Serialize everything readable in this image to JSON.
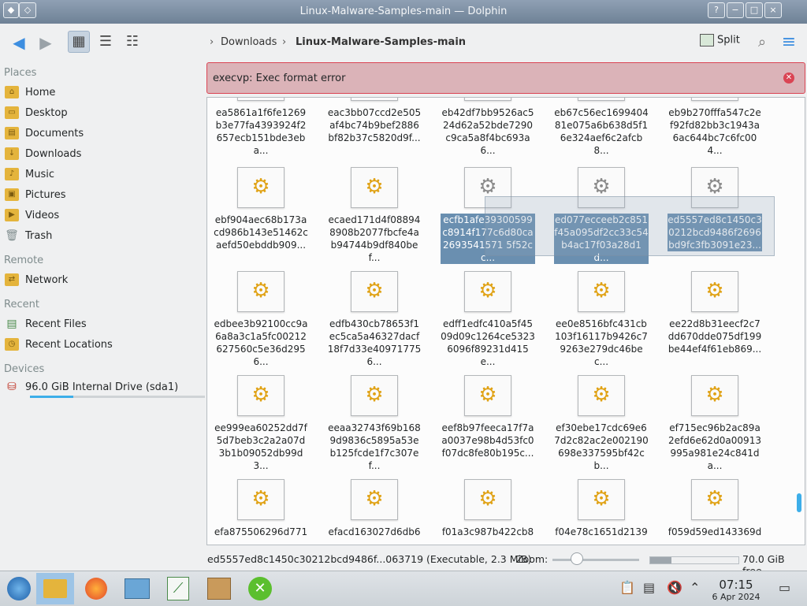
{
  "window": {
    "title": "Linux-Malware-Samples-main — Dolphin",
    "buttons": [
      "?",
      "−",
      "□",
      "×"
    ]
  },
  "toolbar": {
    "back_icon": "back-arrow-icon",
    "forward_icon": "forward-arrow-icon",
    "views": [
      "icons-view",
      "compact-view",
      "details-view"
    ],
    "breadcrumb": [
      "Downloads",
      "Linux-Malware-Samples-main"
    ],
    "split_label": "Split",
    "search_icon": "search-icon",
    "menu_icon": "hamburger-menu-icon"
  },
  "sidebar": {
    "places_header": "Places",
    "places": [
      "Home",
      "Desktop",
      "Documents",
      "Downloads",
      "Music",
      "Pictures",
      "Videos",
      "Trash"
    ],
    "remote_header": "Remote",
    "remote": [
      "Network"
    ],
    "recent_header": "Recent",
    "recent": [
      "Recent Files",
      "Recent Locations"
    ],
    "devices_header": "Devices",
    "devices": [
      "96.0 GiB Internal Drive (sda1)"
    ]
  },
  "error": {
    "message": "execvp: Exec format error",
    "color": "#da4453"
  },
  "files": [
    {
      "name": "ea5861a1f6fe1269b3e77fa4393924f2657ecb151bde3eba...",
      "selected": false
    },
    {
      "name": "eac3bb07ccd2e505af4bc74b9bef2886bf82b37c5820d9f...",
      "selected": false
    },
    {
      "name": "eb42df7bb9526ac524d62a52bde7290c9ca5a8f4bc693a6...",
      "selected": false
    },
    {
      "name": "eb67c56ec169940481e075a6b638d5f16e324aef6c2afcb8...",
      "selected": false
    },
    {
      "name": "eb9b270fffa547c2ef92fd82bb3c1943a6ac644bc7c6fc004...",
      "selected": false
    },
    {
      "name": "ebf904aec68b173acd986b143e51462caefd50ebddb909...",
      "selected": false
    },
    {
      "name": "ecaed171d4f088948908b2077fbcfe4ab94744b9df840bef...",
      "selected": false
    },
    {
      "name": "ecfb1afe39300599c8914f177c6d80ca2693541571 5f52cc...",
      "selected": true
    },
    {
      "name": "ed077ecceeb2c851f45a095df2cc33c54b4ac17f03a28d1d...",
      "selected": true
    },
    {
      "name": "ed5557ed8c1450c30212bcd9486f2696bd9fc3fb3091e23...",
      "selected": true
    },
    {
      "name": "edbee3b92100cc9a6a8a3c1a5fc00212627560c5e36d2956...",
      "selected": false
    },
    {
      "name": "edfb430cb78653f1ec5ca5a46327dacf18f7d33e409717756...",
      "selected": false
    },
    {
      "name": "edff1edfc410a5f4509d09c1264ce53236096f89231d415e...",
      "selected": false
    },
    {
      "name": "ee0e8516bfc431cb103f16117b9426c79263e279dc46bec...",
      "selected": false
    },
    {
      "name": "ee22d8b31eecf2c7dd670dde075df199be44ef4f61eb869...",
      "selected": false
    },
    {
      "name": "ee999ea60252dd7f5d7beb3c2a2a07d3b1b09052db99d3...",
      "selected": false
    },
    {
      "name": "eeaa32743f69b1689d9836c5895a53eb125fcde1f7c307ef...",
      "selected": false
    },
    {
      "name": "eef8b97feeca17f7aa0037e98b4d53fc0f07dc8fe80b195c...",
      "selected": false
    },
    {
      "name": "ef30ebe17cdc69e67d2c82ac2e002190698e337595bf42cb...",
      "selected": false
    },
    {
      "name": "ef715ec96b2ac89a2efd6e62d0a00913995a981e24c841da...",
      "selected": false
    },
    {
      "name": "efa875506296d771",
      "selected": false
    },
    {
      "name": "efacd163027d6db6",
      "selected": false
    },
    {
      "name": "f01a3c987b422cb8",
      "selected": false
    },
    {
      "name": "f04e78c1651d2139",
      "selected": false
    },
    {
      "name": "f059d59ed143369d",
      "selected": false
    }
  ],
  "status": {
    "info": "ed5557ed8c1450c30212bcd9486f...063719 (Executable, 2.3 MiB)",
    "zoom_label": "Zoom:",
    "free_space": "70.0 GiB free"
  },
  "taskbar": {
    "apps": [
      "start-menu",
      "dolphin",
      "firefox",
      "system-settings",
      "task-manager",
      "archive-manager",
      "system-tools"
    ],
    "time": "07:15",
    "date": "6 Apr 2024"
  }
}
